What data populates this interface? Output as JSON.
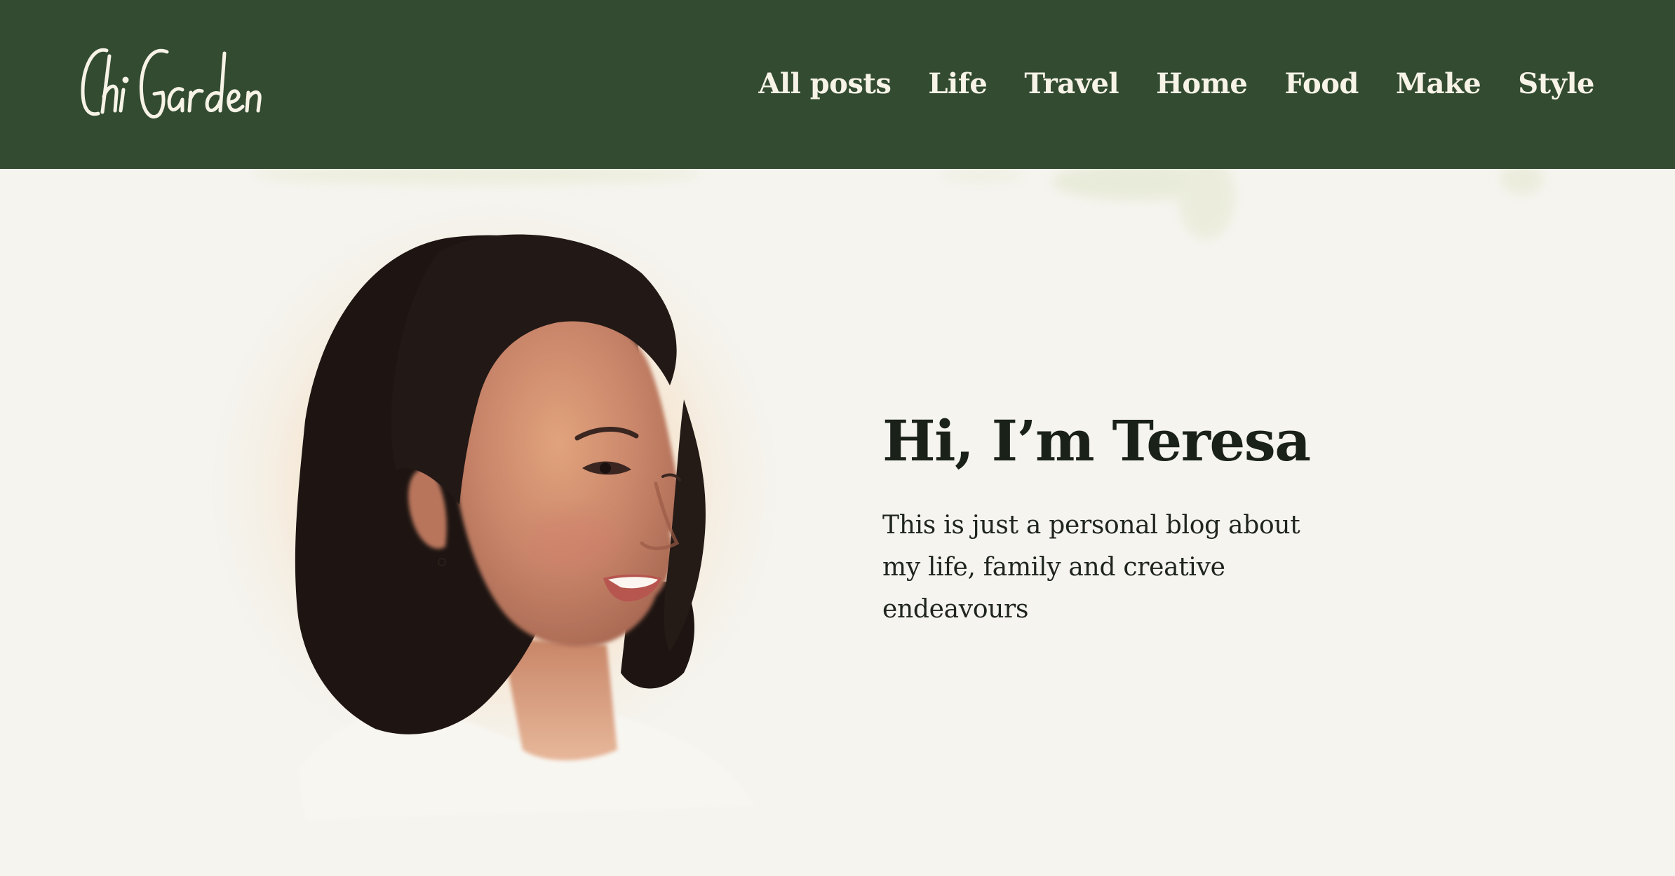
{
  "site": {
    "logo_text": "Chi Garden"
  },
  "nav": {
    "items": [
      {
        "label": "All posts"
      },
      {
        "label": "Life"
      },
      {
        "label": "Travel"
      },
      {
        "label": "Home"
      },
      {
        "label": "Food"
      },
      {
        "label": "Make"
      },
      {
        "label": "Style"
      }
    ]
  },
  "hero": {
    "title": "Hi, I’m Teresa",
    "description": "This is just a personal blog about my life, family and creative endeavours"
  },
  "colors": {
    "header_bg": "#324b31",
    "page_bg": "#f5f4ef",
    "nav_text": "#f7f3e6",
    "heading_text": "#1a2119"
  }
}
